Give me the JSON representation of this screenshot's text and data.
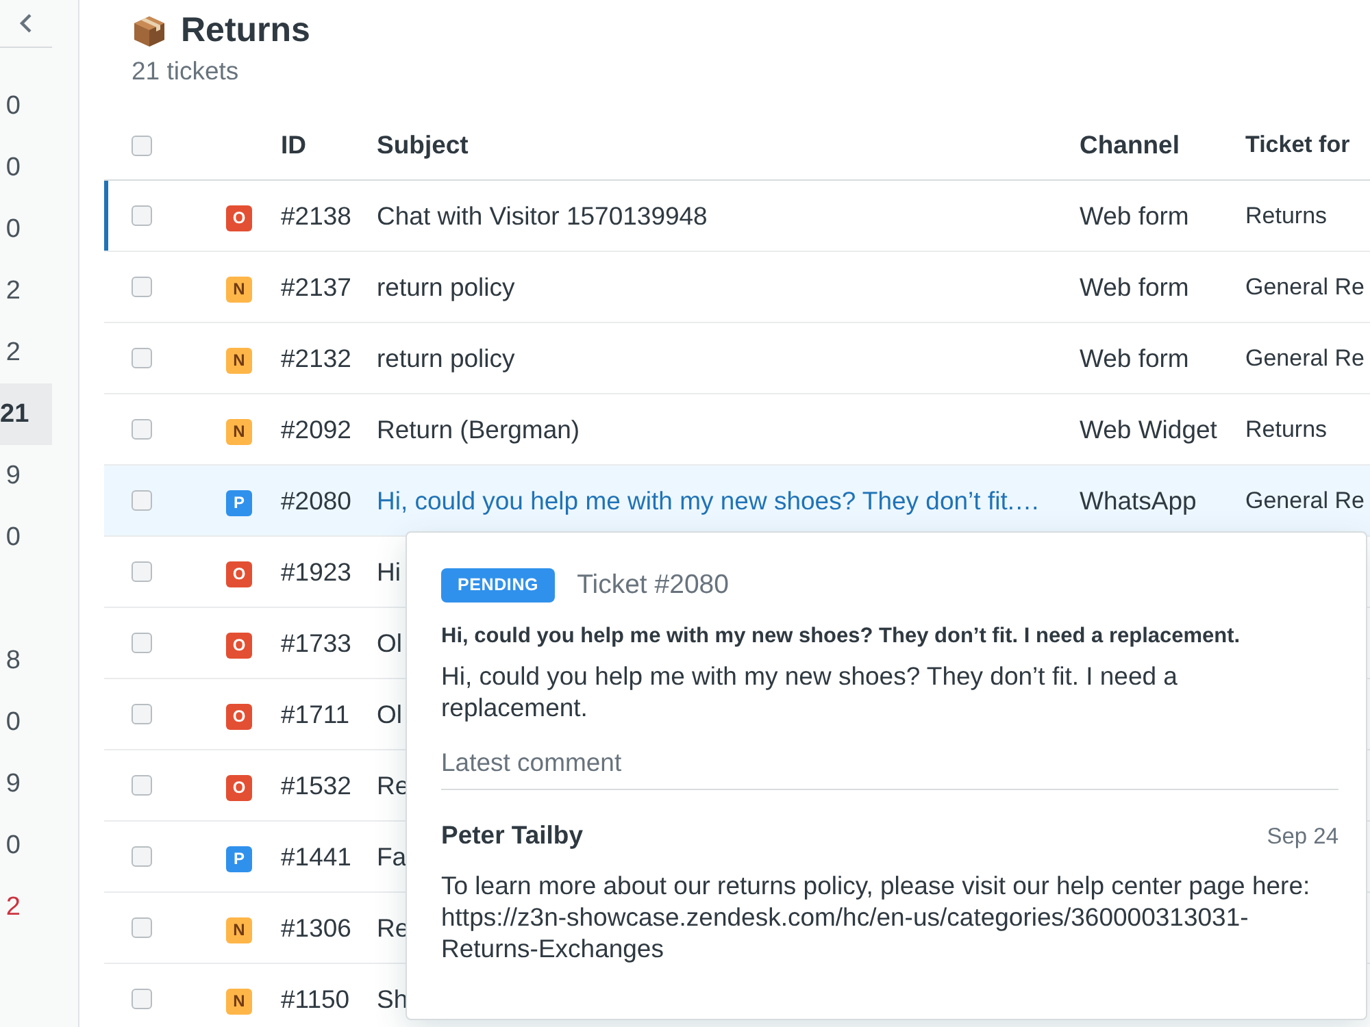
{
  "sidebar": {
    "groups": [
      [
        {
          "text": "0",
          "selected": false,
          "alert": false
        },
        {
          "text": "0",
          "selected": false,
          "alert": false
        },
        {
          "text": "0",
          "selected": false,
          "alert": false
        },
        {
          "text": "2",
          "selected": false,
          "alert": false
        },
        {
          "text": "2",
          "selected": false,
          "alert": false
        },
        {
          "text": "21",
          "selected": true,
          "alert": false
        },
        {
          "text": "9",
          "selected": false,
          "alert": false
        },
        {
          "text": "0",
          "selected": false,
          "alert": false
        }
      ],
      [
        {
          "text": "8",
          "selected": false,
          "alert": false
        },
        {
          "text": "0",
          "selected": false,
          "alert": false
        },
        {
          "text": "9",
          "selected": false,
          "alert": false
        },
        {
          "text": "0",
          "selected": false,
          "alert": false
        },
        {
          "text": "2",
          "selected": false,
          "alert": true
        }
      ]
    ]
  },
  "view": {
    "title": "Returns",
    "subtitle": "21 tickets"
  },
  "table": {
    "header_checked": false,
    "columns": [
      "ID",
      "Subject",
      "Channel",
      "Ticket for"
    ],
    "rows": [
      {
        "checked": false,
        "active": true,
        "hovered": false,
        "status": "O",
        "color": "#e34f32",
        "id": "#2138",
        "subject": "Chat with Visitor 1570139948",
        "channel": "Web form",
        "form": "Returns"
      },
      {
        "checked": false,
        "active": false,
        "hovered": false,
        "status": "N",
        "color": "#ffb648",
        "id": "#2137",
        "subject": "return policy",
        "channel": "Web form",
        "form": "General Re"
      },
      {
        "checked": false,
        "active": false,
        "hovered": false,
        "status": "N",
        "color": "#ffb648",
        "id": "#2132",
        "subject": "return policy",
        "channel": "Web form",
        "form": "General Re"
      },
      {
        "checked": false,
        "active": false,
        "hovered": false,
        "status": "N",
        "color": "#ffb648",
        "id": "#2092",
        "subject": "Return (Bergman)",
        "channel": "Web Widget",
        "form": "Returns"
      },
      {
        "checked": false,
        "active": false,
        "hovered": true,
        "status": "P",
        "color": "#3091ec",
        "id": "#2080",
        "subject": "Hi, could you help me with my new shoes? They don’t fit.…",
        "channel": "WhatsApp",
        "form": "General Re"
      },
      {
        "checked": false,
        "active": false,
        "hovered": false,
        "status": "O",
        "color": "#e34f32",
        "id": "#1923",
        "subject": "Hi"
      },
      {
        "checked": false,
        "active": false,
        "hovered": false,
        "status": "O",
        "color": "#e34f32",
        "id": "#1733",
        "subject": "Ol"
      },
      {
        "checked": false,
        "active": false,
        "hovered": false,
        "status": "O",
        "color": "#e34f32",
        "id": "#1711",
        "subject": "Ol"
      },
      {
        "checked": false,
        "active": false,
        "hovered": false,
        "status": "O",
        "color": "#e34f32",
        "id": "#1532",
        "subject": "Re"
      },
      {
        "checked": false,
        "active": false,
        "hovered": false,
        "status": "P",
        "color": "#3091ec",
        "id": "#1441",
        "subject": "Fa"
      },
      {
        "checked": false,
        "active": false,
        "hovered": false,
        "status": "N",
        "color": "#ffb648",
        "id": "#1306",
        "subject": "Re"
      },
      {
        "checked": false,
        "active": false,
        "hovered": false,
        "status": "N",
        "color": "#ffb648",
        "id": "#1150",
        "subject": "Sh"
      }
    ]
  },
  "popover": {
    "badge": "PENDING",
    "color": "#3091ec",
    "ticket": "Ticket #2080",
    "subject": "Hi, could you help me with my new shoes? They don’t fit. I need a replacement.",
    "description": "Hi, could you help me with my new shoes? They don’t fit. I need a replacement.",
    "section_label": "Latest comment",
    "comment": {
      "author": "Peter Tailby",
      "date": "Sep 24",
      "body": "To learn more about our returns policy, please visit our help center page here: https://z3n-showcase.zendesk.com/hc/en-us/categories/360000313031-Returns-Exchanges"
    }
  }
}
